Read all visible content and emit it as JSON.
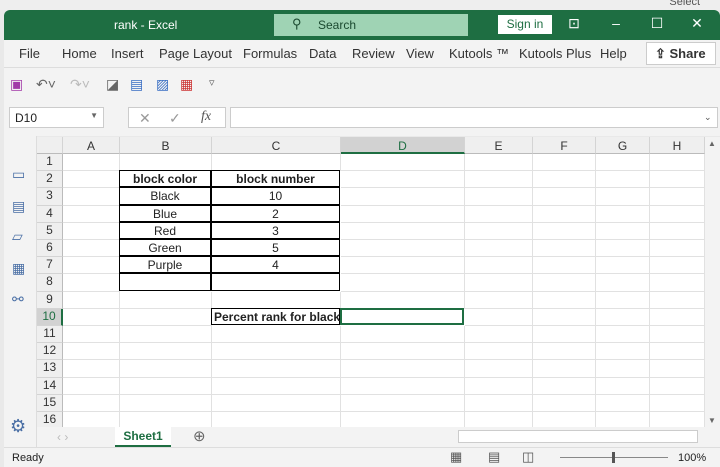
{
  "window": {
    "title": "rank  -  Excel",
    "search_placeholder": "Search",
    "sign_in": "Sign in",
    "top_right_text": "Select"
  },
  "menu": [
    "File",
    "Home",
    "Insert",
    "Page Layout",
    "Formulas",
    "Data",
    "Review",
    "View",
    "Kutools ™",
    "Kutools Plus",
    "Help"
  ],
  "share_label": "Share",
  "formula_bar": {
    "name_box": "D10",
    "fx": "fx",
    "formula": ""
  },
  "columns": [
    "A",
    "B",
    "C",
    "D",
    "E",
    "F",
    "G",
    "H"
  ],
  "rows": [
    "1",
    "2",
    "3",
    "4",
    "5",
    "6",
    "7",
    "8",
    "9",
    "10",
    "11",
    "12",
    "13",
    "14",
    "15",
    "16"
  ],
  "cells": {
    "B2": "block color",
    "C2": "block number",
    "B3": "Black",
    "C3": "10",
    "B4": "Blue",
    "C4": "2",
    "B5": "Red",
    "C5": "3",
    "B6": "Green",
    "C6": "5",
    "B7": "Purple",
    "C7": "4",
    "C10": "Percent rank for black"
  },
  "selected_cell": "D10",
  "sheet_tabs": [
    "Sheet1"
  ],
  "status": {
    "text": "Ready",
    "zoom": "100%"
  },
  "accent_color": "#1e6e42"
}
